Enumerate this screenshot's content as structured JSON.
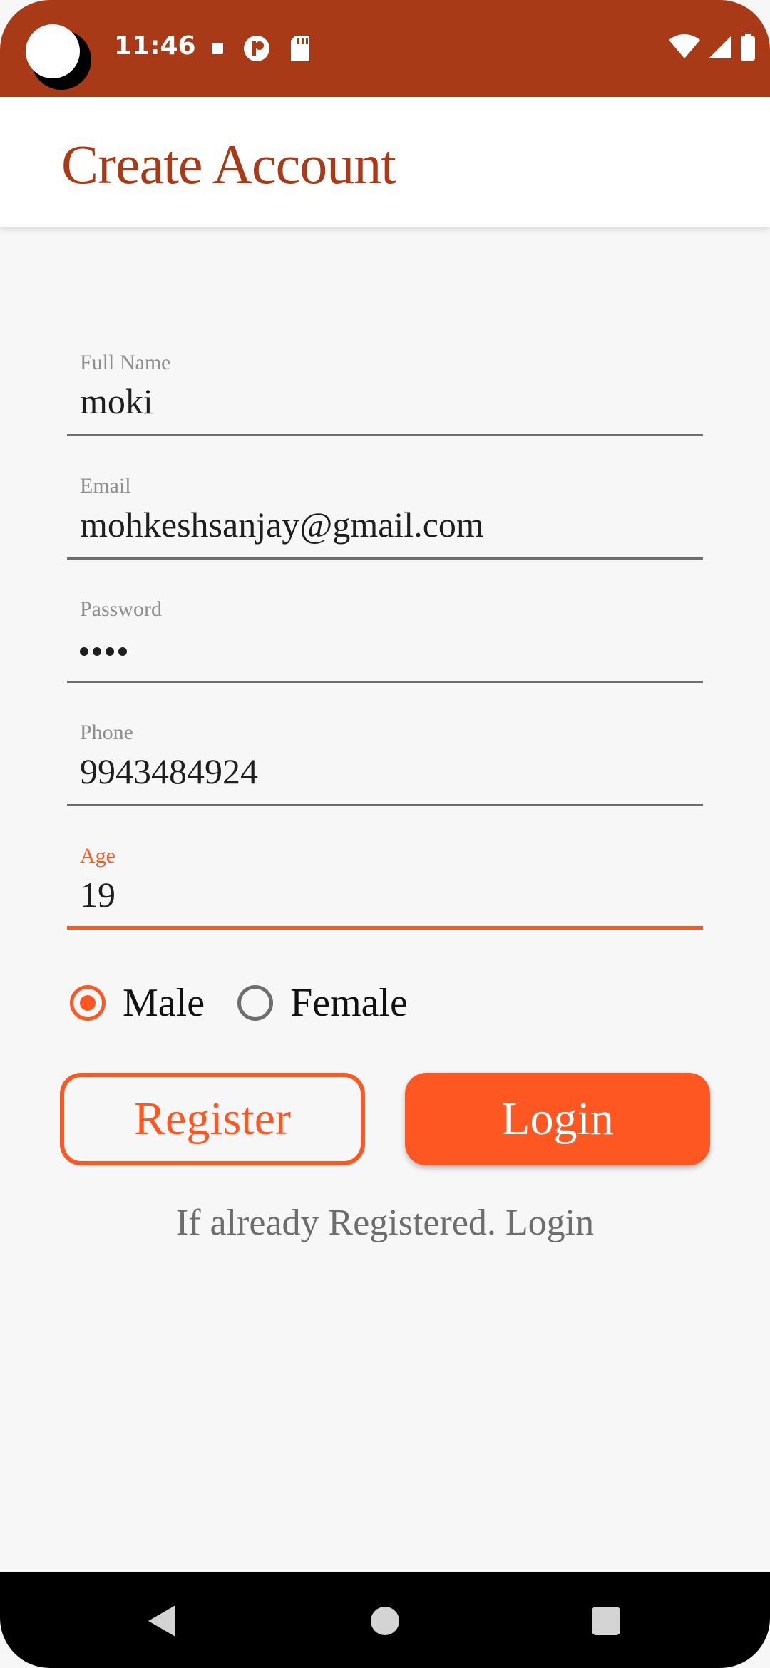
{
  "status_bar": {
    "time": "11:46",
    "left_icons": [
      "camera-cutout-icon",
      "stop-icon",
      "app-notification-icon",
      "sd-card-icon"
    ],
    "right_icons": [
      "wifi-icon",
      "cell-signal-icon",
      "battery-icon"
    ],
    "color": "#a83a17"
  },
  "app_bar": {
    "title": "Create Account"
  },
  "form": {
    "full_name": {
      "label": "Full Name",
      "value": "moki"
    },
    "email": {
      "label": "Email",
      "value": "mohkeshsanjay@gmail.com"
    },
    "password": {
      "label": "Password",
      "masked_length": 4
    },
    "phone": {
      "label": "Phone",
      "value": "9943484924"
    },
    "age": {
      "label": "Age",
      "value": "19",
      "focused": true
    },
    "gender": {
      "options": [
        {
          "label": "Male",
          "checked": true
        },
        {
          "label": "Female",
          "checked": false
        }
      ]
    }
  },
  "buttons": {
    "register": "Register",
    "login": "Login"
  },
  "login_link": "If already Registered. Login",
  "colors": {
    "accent": "#ff5722",
    "title": "#a83a17",
    "background": "#f7f7f7"
  },
  "nav_bar": {
    "icons": [
      "back-icon",
      "home-icon",
      "recents-icon"
    ]
  }
}
